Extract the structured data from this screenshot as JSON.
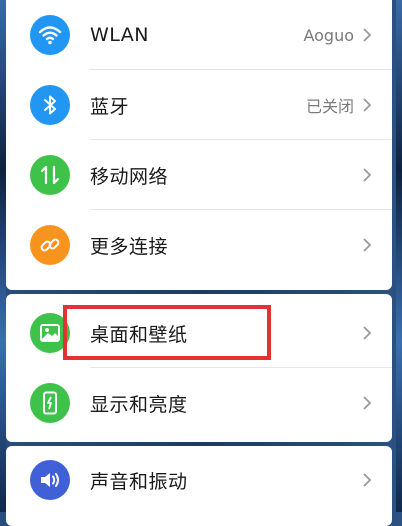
{
  "colors": {
    "blue": "#2196f3",
    "green": "#3fc24a",
    "orange": "#f7941d",
    "indigo": "#4060d8",
    "highlight": "#e03434"
  },
  "settings": {
    "wlan": {
      "label": "WLAN",
      "value": "Aoguo",
      "icon": "wifi-icon"
    },
    "bluetooth": {
      "label": "蓝牙",
      "value": "已关闭",
      "icon": "bluetooth-icon"
    },
    "mobile_network": {
      "label": "移动网络",
      "icon": "data-arrows-icon"
    },
    "more_connections": {
      "label": "更多连接",
      "icon": "link-icon"
    },
    "wallpaper": {
      "label": "桌面和壁纸",
      "icon": "image-icon"
    },
    "display": {
      "label": "显示和亮度",
      "icon": "phone-brightness-icon"
    },
    "sound": {
      "label": "声音和振动",
      "icon": "speaker-icon"
    }
  }
}
